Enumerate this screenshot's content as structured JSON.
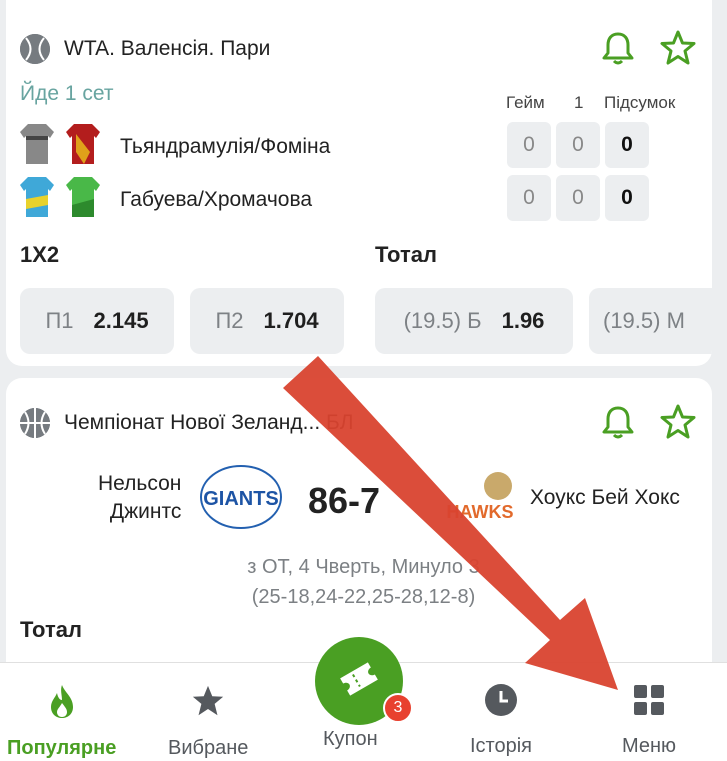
{
  "card1": {
    "league": "WTA. Валенсія. Пари",
    "status": "Йде 1 сет",
    "score_headers": [
      "Гейм",
      "1",
      "Підсумок"
    ],
    "teams": [
      {
        "name": "Тьяндрамулія/Фоміна",
        "scores": [
          "0",
          "0",
          "0"
        ]
      },
      {
        "name": "Габуева/Хромачова",
        "scores": [
          "0",
          "0",
          "0"
        ]
      }
    ],
    "markets": [
      "1X2",
      "Тотал"
    ],
    "odds": [
      {
        "label": "П1",
        "value": "2.145"
      },
      {
        "label": "П2",
        "value": "1.704"
      },
      {
        "label": "(19.5) Б",
        "value": "1.96"
      },
      {
        "label": "(19.5) М",
        "value": ""
      }
    ]
  },
  "card2": {
    "league": "Чемпіонат Нової Зеланд... БЛ",
    "home_team": "Нельсон\nДжинтс",
    "home_line1": "Нельсон",
    "home_line2": "Джинтс",
    "away_team": "Хоукс Бей Хокс",
    "score": "86-76",
    "score_visible": "86-7",
    "home_logo_text": "GIANTS",
    "away_logo_text": "HAWKS",
    "info_line1": "з ОТ, 4 Чверть, Минуло 3",
    "info_line2": "(25-18,24-22,25-28,12-8)",
    "market": "Тотал"
  },
  "nav": {
    "items": [
      {
        "label": "Популярне",
        "icon": "flame-icon",
        "active": true
      },
      {
        "label": "Вибране",
        "icon": "star-icon",
        "active": false
      },
      {
        "label": "Купон",
        "icon": "ticket-icon",
        "active": false
      },
      {
        "label": "Історія",
        "icon": "clock-icon",
        "active": false
      },
      {
        "label": "Меню",
        "icon": "grid-icon",
        "active": false
      }
    ],
    "coupon_badge": "3"
  },
  "colors": {
    "accent": "#4a9f23",
    "status_text": "#68a4a0",
    "arrow": "#d9432f",
    "badge": "#e8412f"
  }
}
